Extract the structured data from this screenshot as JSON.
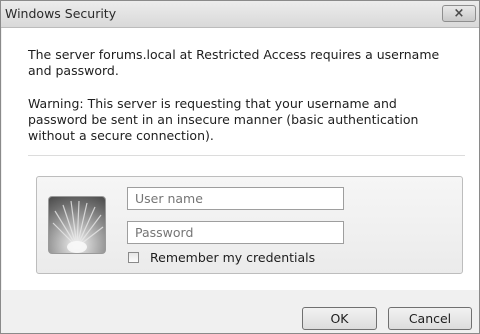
{
  "window": {
    "title": "Windows Security",
    "close_label": "×"
  },
  "message": {
    "line1": "The server forums.local at Restricted Access requires a username and password.",
    "line2": "Warning: This server is requesting that your username and password be sent in an insecure manner (basic authentication without a secure connection)."
  },
  "credentials": {
    "username_placeholder": "User name",
    "password_placeholder": "Password",
    "remember_label": "Remember my credentials",
    "remember_checked": false
  },
  "buttons": {
    "ok_label": "OK",
    "cancel_label": "Cancel"
  }
}
